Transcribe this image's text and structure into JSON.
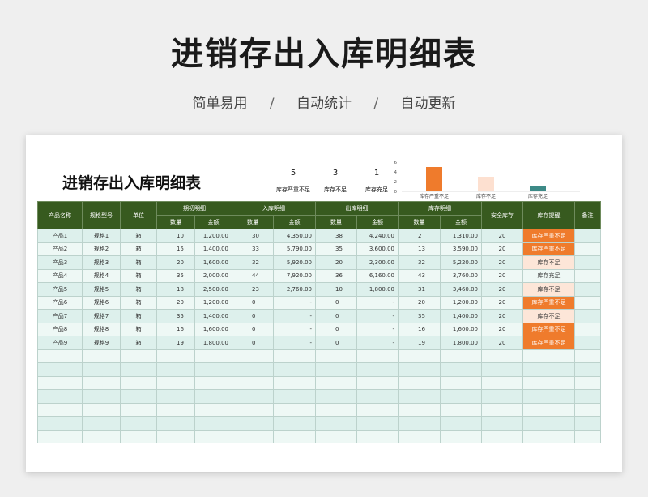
{
  "page": {
    "title": "进销存出入库明细表",
    "subtitle": [
      "简单易用",
      "自动统计",
      "自动更新"
    ],
    "separator": "/"
  },
  "sheet": {
    "title": "进销存出入库明细表",
    "stats": [
      {
        "value": "5",
        "label": "库存严重不足"
      },
      {
        "value": "3",
        "label": "库存不足"
      },
      {
        "value": "1",
        "label": "库存充足"
      }
    ]
  },
  "chart_data": {
    "type": "bar",
    "categories": [
      "库存严重不足",
      "库存不足",
      "库存充足"
    ],
    "values": [
      5,
      3,
      1
    ],
    "colors": [
      "#ef7b2c",
      "#fde0d0",
      "#3d8a87"
    ],
    "yticks": [
      "0",
      "2",
      "4",
      "6"
    ],
    "ylim": [
      0,
      6
    ],
    "grid": false
  },
  "table": {
    "group_headers": {
      "name": "产品名称",
      "spec": "规格型号",
      "unit": "单位",
      "opening": "期初明细",
      "in": "入库明细",
      "out": "出库明细",
      "stock": "库存明细",
      "safety": "安全库存",
      "alert": "库存提醒",
      "note": "备注"
    },
    "sub_headers": {
      "qty": "数量",
      "amt": "金额"
    },
    "rows": [
      {
        "name": "产品1",
        "spec": "规格1",
        "unit": "箱",
        "oq": "10",
        "oa": "1,200.00",
        "iq": "30",
        "ia": "4,350.00",
        "xq": "38",
        "xa": "4,240.00",
        "sq": "2",
        "sa": "1,310.00",
        "safety": "20",
        "alert": "库存严重不足",
        "level": "severe"
      },
      {
        "name": "产品2",
        "spec": "规格2",
        "unit": "箱",
        "oq": "15",
        "oa": "1,400.00",
        "iq": "33",
        "ia": "5,790.00",
        "xq": "35",
        "xa": "3,600.00",
        "sq": "13",
        "sa": "3,590.00",
        "safety": "20",
        "alert": "库存严重不足",
        "level": "severe"
      },
      {
        "name": "产品3",
        "spec": "规格3",
        "unit": "箱",
        "oq": "20",
        "oa": "1,600.00",
        "iq": "32",
        "ia": "5,920.00",
        "xq": "20",
        "xa": "2,300.00",
        "sq": "32",
        "sa": "5,220.00",
        "safety": "20",
        "alert": "库存不足",
        "level": "low"
      },
      {
        "name": "产品4",
        "spec": "规格4",
        "unit": "箱",
        "oq": "35",
        "oa": "2,000.00",
        "iq": "44",
        "ia": "7,920.00",
        "xq": "36",
        "xa": "6,160.00",
        "sq": "43",
        "sa": "3,760.00",
        "safety": "20",
        "alert": "库存充足",
        "level": "ok"
      },
      {
        "name": "产品5",
        "spec": "规格5",
        "unit": "箱",
        "oq": "18",
        "oa": "2,500.00",
        "iq": "23",
        "ia": "2,760.00",
        "xq": "10",
        "xa": "1,800.00",
        "sq": "31",
        "sa": "3,460.00",
        "safety": "20",
        "alert": "库存不足",
        "level": "low"
      },
      {
        "name": "产品6",
        "spec": "规格6",
        "unit": "箱",
        "oq": "20",
        "oa": "1,200.00",
        "iq": "0",
        "ia": "-",
        "xq": "0",
        "xa": "-",
        "sq": "20",
        "sa": "1,200.00",
        "safety": "20",
        "alert": "库存严重不足",
        "level": "severe"
      },
      {
        "name": "产品7",
        "spec": "规格7",
        "unit": "箱",
        "oq": "35",
        "oa": "1,400.00",
        "iq": "0",
        "ia": "-",
        "xq": "0",
        "xa": "-",
        "sq": "35",
        "sa": "1,400.00",
        "safety": "20",
        "alert": "库存不足",
        "level": "low"
      },
      {
        "name": "产品8",
        "spec": "规格8",
        "unit": "箱",
        "oq": "16",
        "oa": "1,600.00",
        "iq": "0",
        "ia": "-",
        "xq": "0",
        "xa": "-",
        "sq": "16",
        "sa": "1,600.00",
        "safety": "20",
        "alert": "库存严重不足",
        "level": "severe"
      },
      {
        "name": "产品9",
        "spec": "规格9",
        "unit": "箱",
        "oq": "19",
        "oa": "1,800.00",
        "iq": "0",
        "ia": "-",
        "xq": "0",
        "xa": "-",
        "sq": "19",
        "sa": "1,800.00",
        "safety": "20",
        "alert": "库存严重不足",
        "level": "severe"
      }
    ],
    "empty_rows": 7
  }
}
